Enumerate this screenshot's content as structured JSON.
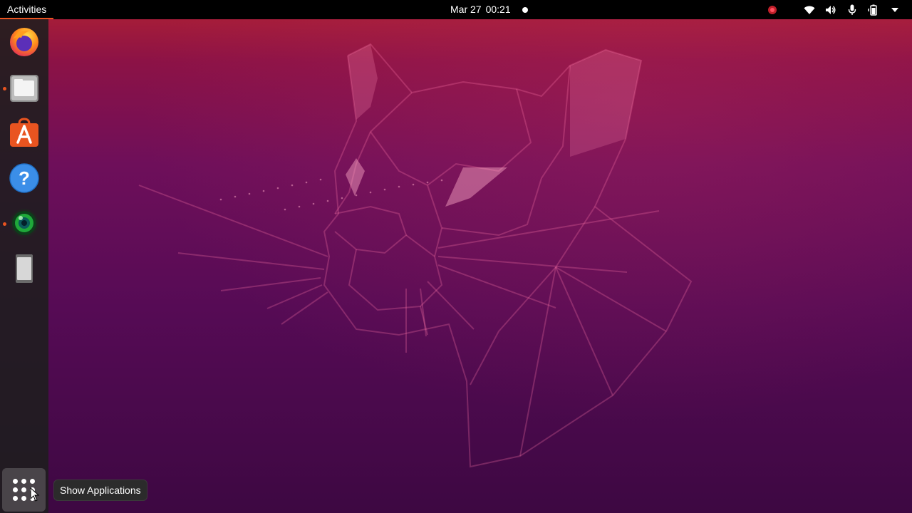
{
  "topbar": {
    "activities_label": "Activities",
    "date": "Mar 27",
    "time": "00:21"
  },
  "status_icons": [
    "record-indicator-icon",
    "wifi-icon",
    "volume-icon",
    "microphone-icon",
    "battery-icon",
    "system-menu-chevron-icon"
  ],
  "dock": {
    "items": [
      {
        "name": "firefox",
        "running": false
      },
      {
        "name": "files",
        "running": true
      },
      {
        "name": "ubuntu-software",
        "running": false
      },
      {
        "name": "help",
        "running": false
      },
      {
        "name": "webcam-app",
        "running": true
      },
      {
        "name": "removable-device",
        "running": false
      }
    ],
    "show_apps_tooltip": "Show Applications"
  },
  "colors": {
    "accent": "#e95420",
    "topbar": "#000000",
    "wallpaper_top": "#b02133",
    "wallpaper_bottom": "#3d0842"
  }
}
